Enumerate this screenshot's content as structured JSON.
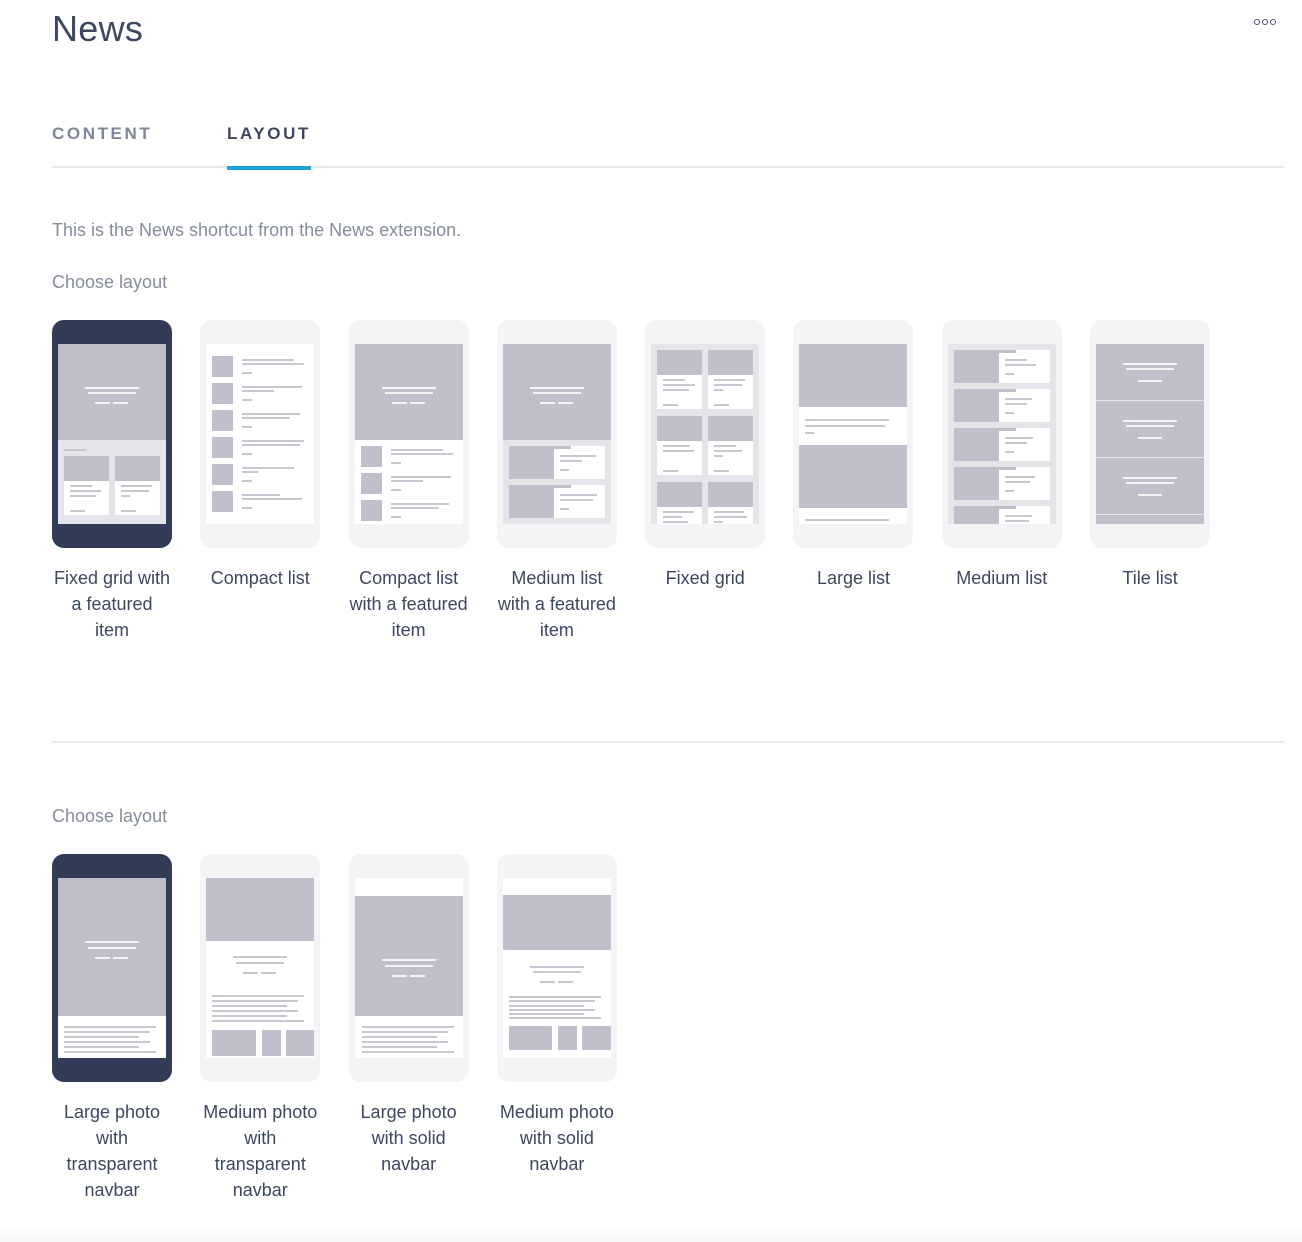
{
  "header": {
    "title": "News",
    "more_icon": "more-horizontal-icon"
  },
  "tabs": [
    {
      "label": "CONTENT",
      "active": false
    },
    {
      "label": "LAYOUT",
      "active": true
    }
  ],
  "colors": {
    "accent": "#1ea3dd",
    "selected_frame": "#323c56",
    "title_text": "#3d4760",
    "muted_text": "#858c9b"
  },
  "description": "This is the News shortcut from the News extension.",
  "list_layouts": {
    "label": "Choose layout",
    "selected_index": 0,
    "options": [
      {
        "label": "Fixed grid with a featured item",
        "preview": "fixed-grid-featured"
      },
      {
        "label": "Compact list",
        "preview": "compact-list"
      },
      {
        "label": "Compact list with a featured item",
        "preview": "compact-list-featured"
      },
      {
        "label": "Medium list with a featured item",
        "preview": "medium-list-featured"
      },
      {
        "label": "Fixed grid",
        "preview": "fixed-grid"
      },
      {
        "label": "Large list",
        "preview": "large-list"
      },
      {
        "label": "Medium list",
        "preview": "medium-list"
      },
      {
        "label": "Tile list",
        "preview": "tile-list"
      }
    ]
  },
  "detail_layouts": {
    "label": "Choose layout",
    "selected_index": 0,
    "options": [
      {
        "label": "Large photo with transparent navbar",
        "preview": "large-photo-transparent"
      },
      {
        "label": "Medium photo with transparent navbar",
        "preview": "medium-photo-transparent"
      },
      {
        "label": "Large photo with solid navbar",
        "preview": "large-photo-solid"
      },
      {
        "label": "Medium photo with solid navbar",
        "preview": "medium-photo-solid"
      }
    ]
  }
}
